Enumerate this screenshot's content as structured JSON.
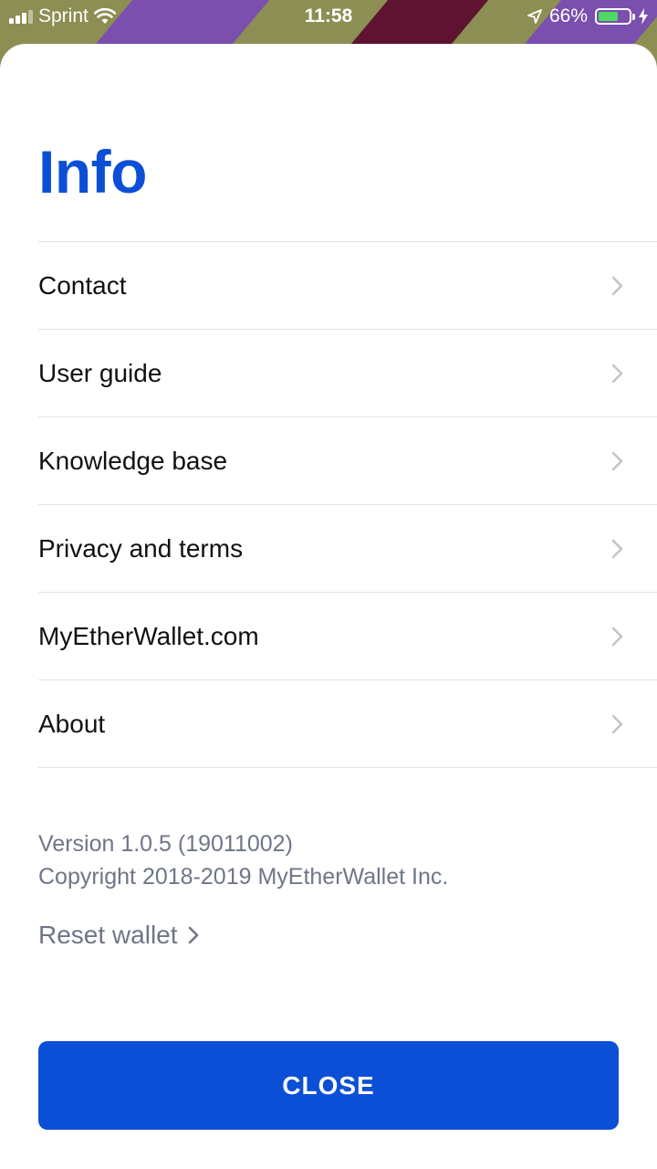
{
  "status_bar": {
    "carrier": "Sprint",
    "time": "11:58",
    "battery_percent": "66%",
    "battery_level": 0.66,
    "battery_color": "#4cd964"
  },
  "page": {
    "title": "Info",
    "accent_color": "#0b4fd6"
  },
  "menu": {
    "items": [
      {
        "label": "Contact",
        "icon": "chevron-right-icon"
      },
      {
        "label": "User guide",
        "icon": "chevron-right-icon"
      },
      {
        "label": "Knowledge base",
        "icon": "chevron-right-icon"
      },
      {
        "label": "Privacy and terms",
        "icon": "chevron-right-icon"
      },
      {
        "label": "MyEtherWallet.com",
        "icon": "chevron-right-icon"
      },
      {
        "label": "About",
        "icon": "chevron-right-icon"
      }
    ]
  },
  "footer": {
    "version": "Version 1.0.5 (19011002)",
    "copyright": "Copyright 2018-2019 MyEtherWallet Inc.",
    "reset_label": "Reset wallet"
  },
  "close_button": {
    "label": "CLOSE"
  }
}
